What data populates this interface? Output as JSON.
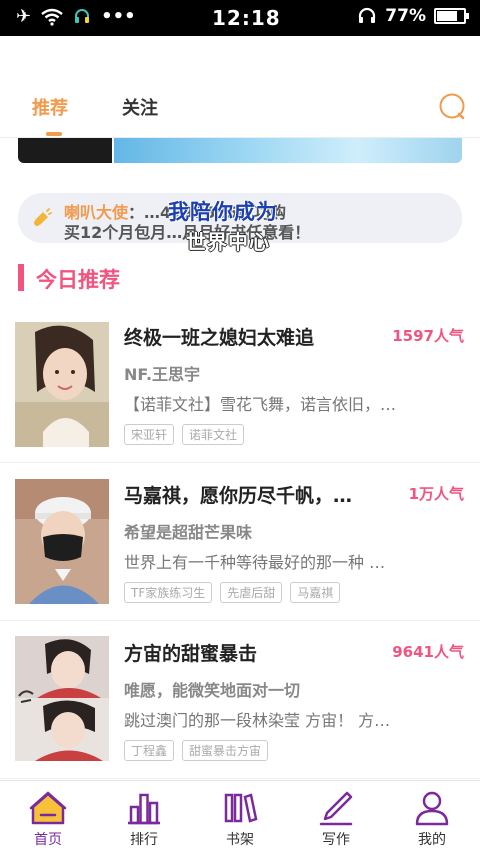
{
  "status_bar": {
    "time": "12:18",
    "battery_level": "77%",
    "battery_fraction": 0.77,
    "icons": [
      "airplane-mode-icon",
      "wifi-icon",
      "headset-app-icon",
      "more-dots-icon",
      "headphone-icon",
      "battery-icon"
    ]
  },
  "tabs": [
    {
      "label": "推荐",
      "active": true
    },
    {
      "label": "关注",
      "active": false
    }
  ],
  "announcement": {
    "label": "喇叭大使",
    "message_line1": "：…4197535成功购",
    "message_line2": "买12个月包月…月月好书任意看！",
    "overlay_title": "我陪你成为",
    "overlay_subtitle": "世界中心"
  },
  "section": {
    "title": "今日推荐"
  },
  "books": [
    {
      "title": "终极一班之媳妇太难追",
      "popularity": "1597人气",
      "author": "NF.王思宇",
      "description": "【诺菲文社】雪花飞舞，诺言依旧，…",
      "tags": [
        "宋亚轩",
        "诺菲文社"
      ]
    },
    {
      "title": "马嘉祺，愿你历尽千帆，…",
      "popularity": "1万人气",
      "author": "希望是超甜芒果味",
      "description": "世界上有一千种等待最好的那一种 …",
      "tags": [
        "TF家族练习生",
        "先虐后甜",
        "马嘉祺"
      ]
    },
    {
      "title": "方宙的甜蜜暴击",
      "popularity": "9641人气",
      "author": "唯愿，能微笑地面对一切",
      "description": "跳过澳门的那一段林染莹  方宙！ 方…",
      "tags": [
        "丁程鑫",
        "甜蜜暴击方宙"
      ]
    }
  ],
  "bottom_nav": [
    {
      "label": "首页",
      "icon": "home-icon",
      "active": true
    },
    {
      "label": "排行",
      "icon": "ranking-icon",
      "active": false
    },
    {
      "label": "书架",
      "icon": "bookshelf-icon",
      "active": false
    },
    {
      "label": "写作",
      "icon": "pen-icon",
      "active": false
    },
    {
      "label": "我的",
      "icon": "profile-icon",
      "active": false
    }
  ],
  "colors": {
    "accent_orange": "#f29a4d",
    "accent_pink": "#f0547f",
    "nav_purple": "#7b2a9c",
    "home_icon_yellow": "#f7c23a"
  }
}
